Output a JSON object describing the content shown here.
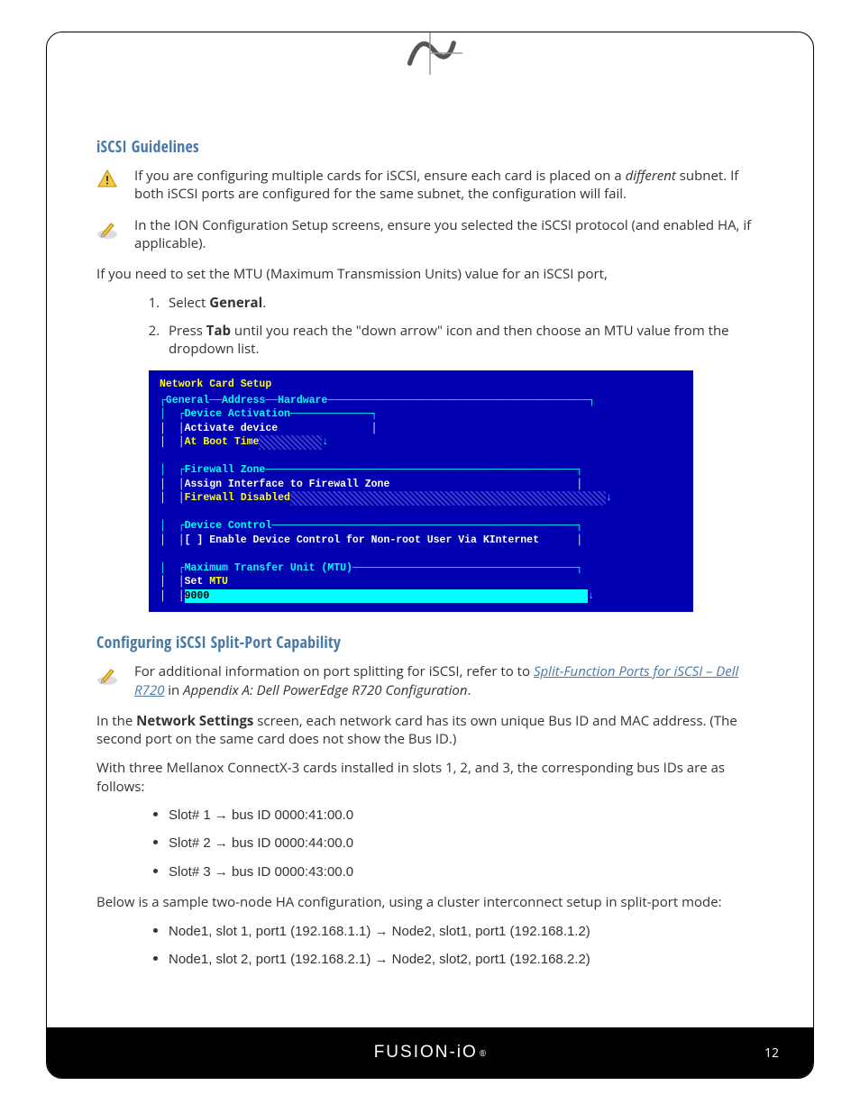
{
  "headings": {
    "h1": "iSCSI Guidelines",
    "h2": "Configuring iSCSI Split-Port Capability"
  },
  "notes": {
    "warn1_a": "If you are configuring multiple cards for iSCSI, ensure each card is placed on a ",
    "warn1_em": "different",
    "warn1_b": " subnet. If both iSCSI ports are configured for the same subnet, the configuration will fail.",
    "pencil1": "In the ION Configuration Setup screens, ensure you selected the iSCSI protocol (and enabled HA, if applicable)."
  },
  "body1": "If you need to set the MTU (Maximum Transmission Units) value for an iSCSI port,",
  "steps": {
    "s1_a": "Select ",
    "s1_b": "General",
    "s1_c": ".",
    "s2_a": "Press ",
    "s2_b": "Tab",
    "s2_c": " until you reach the \"down arrow\" icon and then choose an MTU value from the dropdown list."
  },
  "terminal": {
    "title": "Network Card Setup",
    "tabs": "┌General──Address──Hardware──────────────────────────────────────────┐\n│  ┌Device Activation─────────────┐",
    "act1": "│  │Activate device               │",
    "act2_a": "│  │",
    "act2_b": "At Boot Time",
    "fz_head": "│  ┌Firewall Zone──────────────────────────────────────────────────┐",
    "fz1": "│  │Assign Interface to Firewall Zone                              │",
    "fz2_a": "│  │",
    "fz2_b": "Firewall Disabled",
    "dc_head": "│  ┌Device Control─────────────────────────────────────────────────┐",
    "dc1": "│  │[ ] Enable Device Control for Non-root User Via KInternet      │",
    "mtu_head": "│  ┌Maximum Transfer Unit (MTU)────────────────────────────────────┐",
    "mtu1_a": "│  │Set ",
    "mtu1_b": "MTU",
    "mtu_val": "9000"
  },
  "section2": {
    "pencil_a": "For additional information on port splitting for iSCSI, refer to to ",
    "pencil_link": "Split-Function Ports for iSCSI – Dell R720",
    "pencil_b": " in ",
    "pencil_em": "Appendix A: Dell PowerEdge R720 Configuration",
    "pencil_c": ".",
    "p1_a": "In the ",
    "p1_b": "Network Settings",
    "p1_c": " screen, each network card has its own unique Bus ID and MAC address. (The second port on the same card does not show the Bus ID.)",
    "p2": "With three Mellanox ConnectX-3 cards installed in slots 1, 2, and 3, the corresponding bus IDs are as follows:",
    "slots": {
      "s1": "Slot# 1 → bus ID  0000:41:00.0",
      "s2": "Slot# 2 → bus ID  0000:44:00.0",
      "s3": "Slot# 3 → bus ID  0000:43:00.0"
    },
    "p3": "Below is a sample two-node HA configuration, using a cluster interconnect setup in split-port mode:",
    "nodes": {
      "n1": "Node1, slot 1, port1  (192.168.1.1) → Node2, slot1, port1 (192.168.1.2)",
      "n2": "Node1, slot 2, port1  (192.168.2.1) → Node2, slot2, port1 (192.168.2.2)"
    }
  },
  "footer": {
    "brand": "FUSION-iO",
    "page": "12"
  }
}
